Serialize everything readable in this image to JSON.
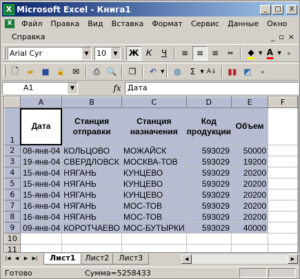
{
  "window": {
    "title": "Microsoft Excel - Книга1",
    "app_icon_letter": "X",
    "minimize": "_",
    "restore": "□",
    "close": "X"
  },
  "menu": {
    "items": [
      "Файл",
      "Правка",
      "Вид",
      "Вставка",
      "Формат",
      "Сервис",
      "Данные",
      "Окно"
    ],
    "help": "Справка",
    "doc_minimize": "_",
    "doc_restore": "▫",
    "doc_close": "×"
  },
  "format_toolbar": {
    "font_name": "Arial Cyr",
    "font_size": "10",
    "bold": "Ж",
    "italic": "К",
    "underline": "Ч"
  },
  "formula_bar": {
    "name_box": "A1",
    "fx": "fx",
    "value": "Дата"
  },
  "columns": [
    "A",
    "B",
    "C",
    "D",
    "E",
    "F"
  ],
  "header_row": {
    "row_number": "1",
    "cells": [
      "Дата",
      "Станция отправки",
      "Станция назначения",
      "Код продукции",
      "Объем"
    ]
  },
  "rows": [
    {
      "n": "2",
      "cells": [
        "08-янв-04",
        "КОЛЬЦОВО",
        "МОЖАЙСК",
        "593029",
        "50000"
      ]
    },
    {
      "n": "3",
      "cells": [
        "19-янв-04",
        "СВЕРДЛОВСК",
        "МОСКВА-ТОВ",
        "593029",
        "19200"
      ]
    },
    {
      "n": "4",
      "cells": [
        "15-янв-04",
        "НЯГАНЬ",
        "КУНЦЕВО",
        "593029",
        "20200"
      ]
    },
    {
      "n": "5",
      "cells": [
        "15-янв-04",
        "НЯГАНЬ",
        "КУНЦЕВО",
        "593029",
        "20200"
      ]
    },
    {
      "n": "6",
      "cells": [
        "15-янв-04",
        "НЯГАНЬ",
        "КУНЦЕВО",
        "593029",
        "20200"
      ]
    },
    {
      "n": "7",
      "cells": [
        "16-янв-04",
        "НЯГАНЬ",
        "МОС-ТОВ",
        "593029",
        "20200"
      ]
    },
    {
      "n": "8",
      "cells": [
        "16-янв-04",
        "НЯГАНЬ",
        "МОС-ТОВ",
        "593029",
        "20200"
      ]
    },
    {
      "n": "9",
      "cells": [
        "09-янв-04",
        "КОРОТЧАЕВО",
        "МОС-БУТЫРКИ",
        "593029",
        "40000"
      ]
    }
  ],
  "empty_rows": [
    "10",
    "11"
  ],
  "sheets": [
    "Лист1",
    "Лист2",
    "Лист3"
  ],
  "status": {
    "mode": "Готово",
    "sum": "Сумма=5258433"
  },
  "colors": {
    "selection": "#b6bdd2",
    "titlebar_start": "#0a246a",
    "titlebar_end": "#a6caf0"
  }
}
